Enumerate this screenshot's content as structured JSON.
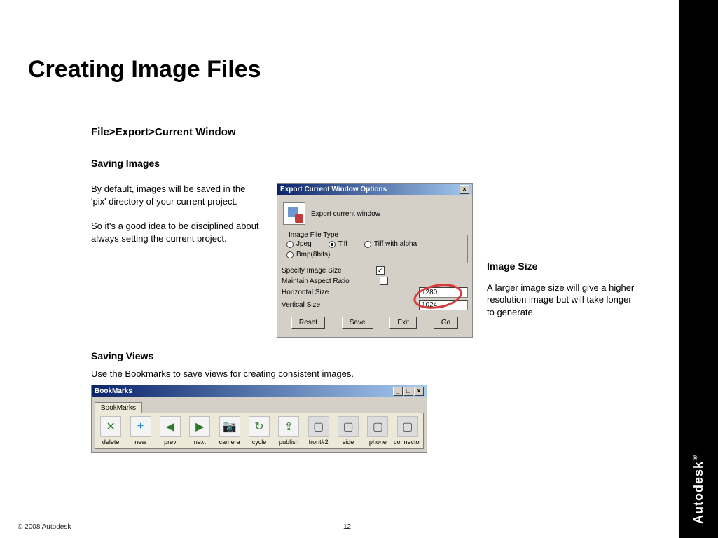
{
  "title": "Creating Image Files",
  "menupath": "File>Export>Current Window",
  "section1_heading": "Saving Images",
  "section1_p1": "By default, images will be saved in the 'pix' directory of your current project.",
  "section1_p2": "So it's a good idea to be disciplined about always setting the current project.",
  "dialog": {
    "title": "Export Current Window Options",
    "close": "×",
    "heading": "Export current window",
    "filetype_legend": "Image File Type",
    "opt_jpeg": "Jpeg",
    "opt_tiff": "Tiff",
    "opt_tiff_alpha": "Tiff with alpha",
    "opt_bmp": "Bmp(8bits)",
    "lbl_specify": "Specify Image Size",
    "chk_specify": "✓",
    "lbl_aspect": "Maintain Aspect Ratio",
    "lbl_hsize": "Horizontal Size",
    "val_hsize": "1280",
    "lbl_vsize": "Vertical Size",
    "val_vsize": "1024",
    "btn_reset": "Reset",
    "btn_save": "Save",
    "btn_exit": "Exit",
    "btn_go": "Go"
  },
  "right": {
    "heading": "Image Size",
    "body": "A larger image size will give a higher resolution image but will take longer to generate."
  },
  "section2_heading": "Saving Views",
  "section2_desc": "Use the Bookmarks to save views for creating consistent images.",
  "bookmarks": {
    "title": "BookMarks",
    "tab": "BookMarks",
    "min": "_",
    "max": "□",
    "close": "×",
    "items": [
      {
        "icon": "✕",
        "label": "delete"
      },
      {
        "icon": "+",
        "label": "new"
      },
      {
        "icon": "◀",
        "label": "prev"
      },
      {
        "icon": "▶",
        "label": "next"
      },
      {
        "icon": "📷",
        "label": "camera"
      },
      {
        "icon": "↻",
        "label": "cycle"
      },
      {
        "icon": "⇪",
        "label": "publish"
      },
      {
        "icon": "▢",
        "label": "front#2"
      },
      {
        "icon": "▢",
        "label": "side"
      },
      {
        "icon": "▢",
        "label": "phone"
      },
      {
        "icon": "▢",
        "label": "connector"
      }
    ]
  },
  "footer": "© 2008 Autodesk",
  "page": "12",
  "brand": "Autodesk"
}
